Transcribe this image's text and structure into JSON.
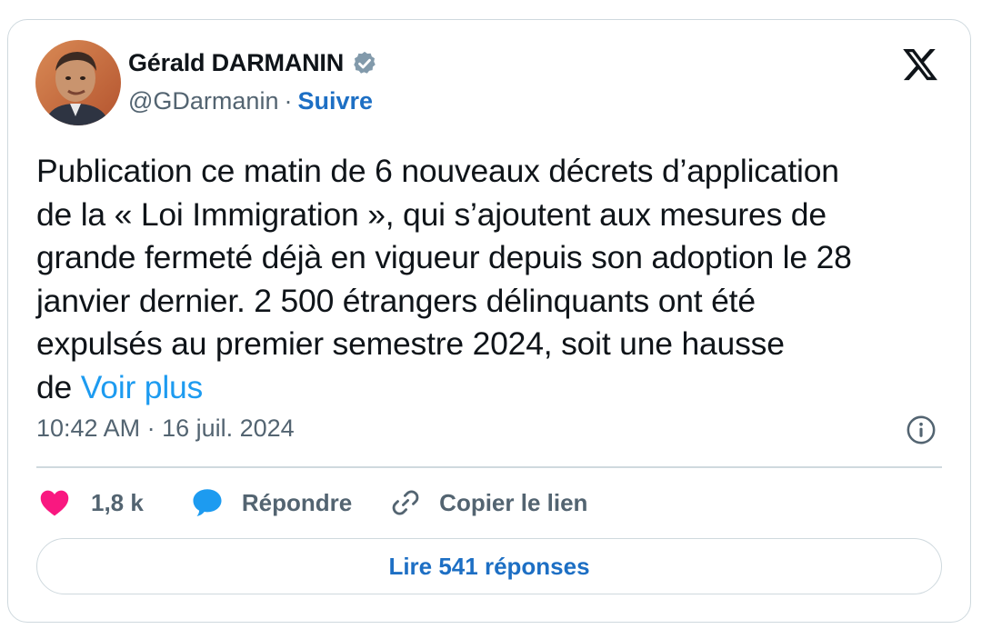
{
  "author": {
    "display_name": "Gérald DARMANIN",
    "handle": "@GDarmanin",
    "separator": "·",
    "follow_label": "Suivre",
    "verified": true,
    "verified_color": "#829aab"
  },
  "tweet": {
    "text": "Publication ce matin de 6 nouveaux décrets d’application\nde la « Loi Immigration », qui s’ajoutent aux mesures de\ngrande fermeté déjà en vigueur depuis son adoption le 28\njanvier dernier. 2 500 étrangers délinquants ont été\nexpulsés au premier semestre 2024, soit une hausse\nde ",
    "see_more_label": "Voir plus",
    "timestamp": "10:42 AM · 16 juil. 2024"
  },
  "actions": {
    "like_count": "1,8 k",
    "reply_label": "Répondre",
    "copy_link_label": "Copier le lien"
  },
  "read_replies_label": "Lire 541 réponses",
  "icons": {
    "platform_logo": "x-logo-icon",
    "verified": "verified-badge-icon",
    "info": "info-icon",
    "like": "heart-icon",
    "reply": "speech-bubble-icon",
    "copy_link": "link-icon"
  },
  "colors": {
    "link_blue": "#1d9bf0",
    "heart_pink": "#f91880",
    "reply_blue": "#1d9bf0",
    "secondary_text": "#536471",
    "border": "#cfd9de"
  }
}
